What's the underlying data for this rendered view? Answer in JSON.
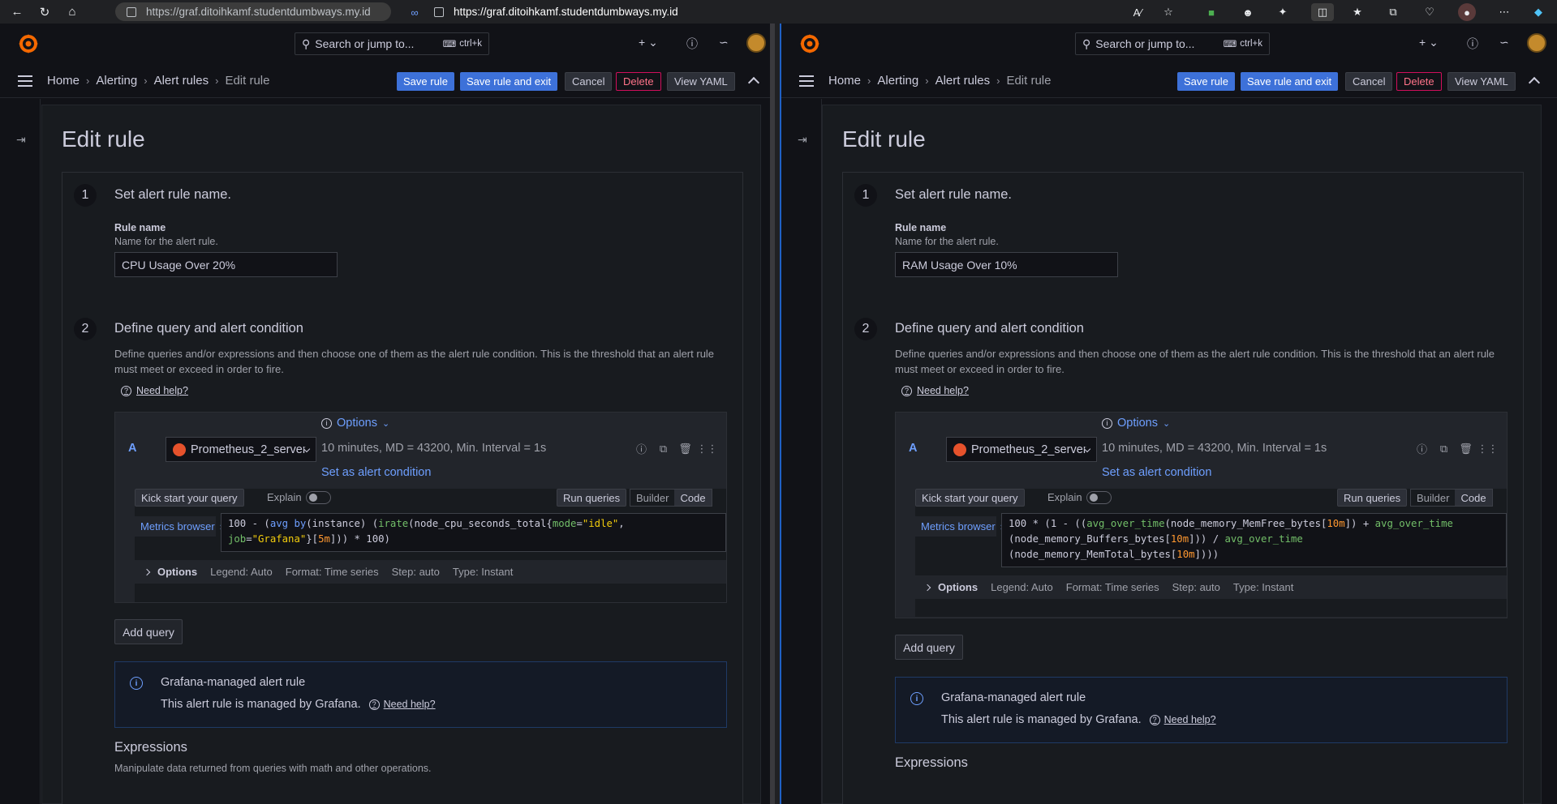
{
  "browser": {
    "url_left": "https://graf.ditoihkamf.studentdumbways.my.id",
    "url_right": "https://graf.ditoihkamf.studentdumbways.my.id"
  },
  "grafana": {
    "search_placeholder": "Search or jump to...",
    "search_shortcut": "ctrl+k",
    "breadcrumbs": [
      "Home",
      "Alerting",
      "Alert rules",
      "Edit rule"
    ],
    "actions": {
      "save": "Save rule",
      "save_exit": "Save rule and exit",
      "cancel": "Cancel",
      "delete": "Delete",
      "view_yaml": "View YAML"
    },
    "page_title": "Edit rule",
    "step1_title": "Set alert rule name.",
    "rule_name_label": "Rule name",
    "rule_name_sub": "Name for the alert rule.",
    "step2_title": "Define query and alert condition",
    "step2_desc": "Define queries and/or expressions and then choose one of them as the alert rule condition. This is the threshold that an alert rule must meet or exceed in order to fire.",
    "need_help": "Need help?",
    "options_label": "Options",
    "query_letter": "A",
    "datasource": "Prometheus_2_server",
    "query_info": "10 minutes, MD = 43200, Min. Interval = 1s",
    "set_condition": "Set as alert condition",
    "kick_start": "Kick start your query",
    "explain": "Explain",
    "run_queries": "Run queries",
    "builder": "Builder",
    "code": "Code",
    "metrics_browser": "Metrics browser",
    "opt_title": "Options",
    "opt_legend": "Legend: Auto",
    "opt_format": "Format: Time series",
    "opt_step": "Step: auto",
    "opt_type": "Type: Instant",
    "add_query": "Add query",
    "info_title": "Grafana-managed alert rule",
    "info_body": "This alert rule is managed by Grafana.",
    "expressions_title": "Expressions",
    "expressions_desc": "Manipulate data returned from queries with math and other operations."
  },
  "left_rule": {
    "name": "CPU Usage Over 20%"
  },
  "right_rule": {
    "name": "RAM Usage Over 10%"
  },
  "colors": {
    "primary": "#3d71d9",
    "link": "#6e9fff",
    "danger": "#ff7389",
    "bg": "#111217",
    "panel": "#181b1f"
  }
}
